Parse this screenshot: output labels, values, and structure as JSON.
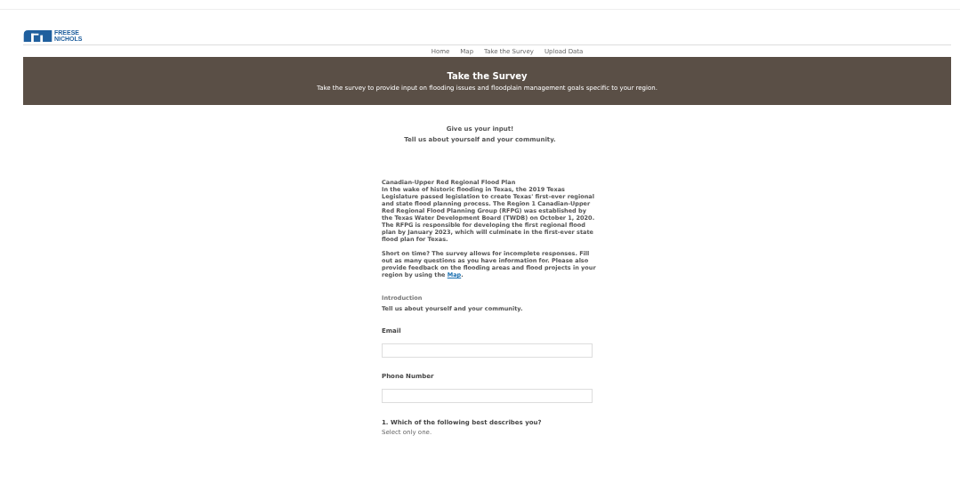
{
  "logo": {
    "lines": [
      "FREESE",
      "NICHOLS"
    ]
  },
  "nav": [
    {
      "label": "Home"
    },
    {
      "label": "Map"
    },
    {
      "label": "Take the Survey"
    },
    {
      "label": "Upload Data"
    }
  ],
  "banner": {
    "title": "Take the Survey",
    "subtitle": "Take the survey to provide input on flooding issues and floodplain management goals specific to your region."
  },
  "intro": {
    "heading": "Give us your input!",
    "subheading": "Tell us about yourself and your community."
  },
  "about": {
    "title": "Canadian-Upper Red Regional Flood Plan",
    "body": "In the wake of historic flooding in Texas, the 2019 Texas Legislature passed legislation to create Texas' first-ever regional and state flood planning process. The Region 1 Canadian-Upper Red Regional Flood Planning Group (RFPG) was established by the Texas Water Development Board (TWDB) on October 1, 2020. The RFPG is responsible for developing the first regional flood plan by January 2023, which will culminate in the first-ever state flood plan for Texas.",
    "note": "Short on time? The survey allows for incomplete responses. Fill out as many questions as you have information for. Please also provide feedback on the flooding areas and flood projects in your region by using the",
    "link": "Map",
    "note_end": "."
  },
  "section": {
    "title": "Introduction",
    "subtitle": "Tell us about yourself and your community."
  },
  "fields": [
    {
      "label": "Email"
    },
    {
      "label": "Phone Number"
    }
  ],
  "question": {
    "text": "1. Which of the following best describes you?",
    "hint": "Select only one."
  }
}
